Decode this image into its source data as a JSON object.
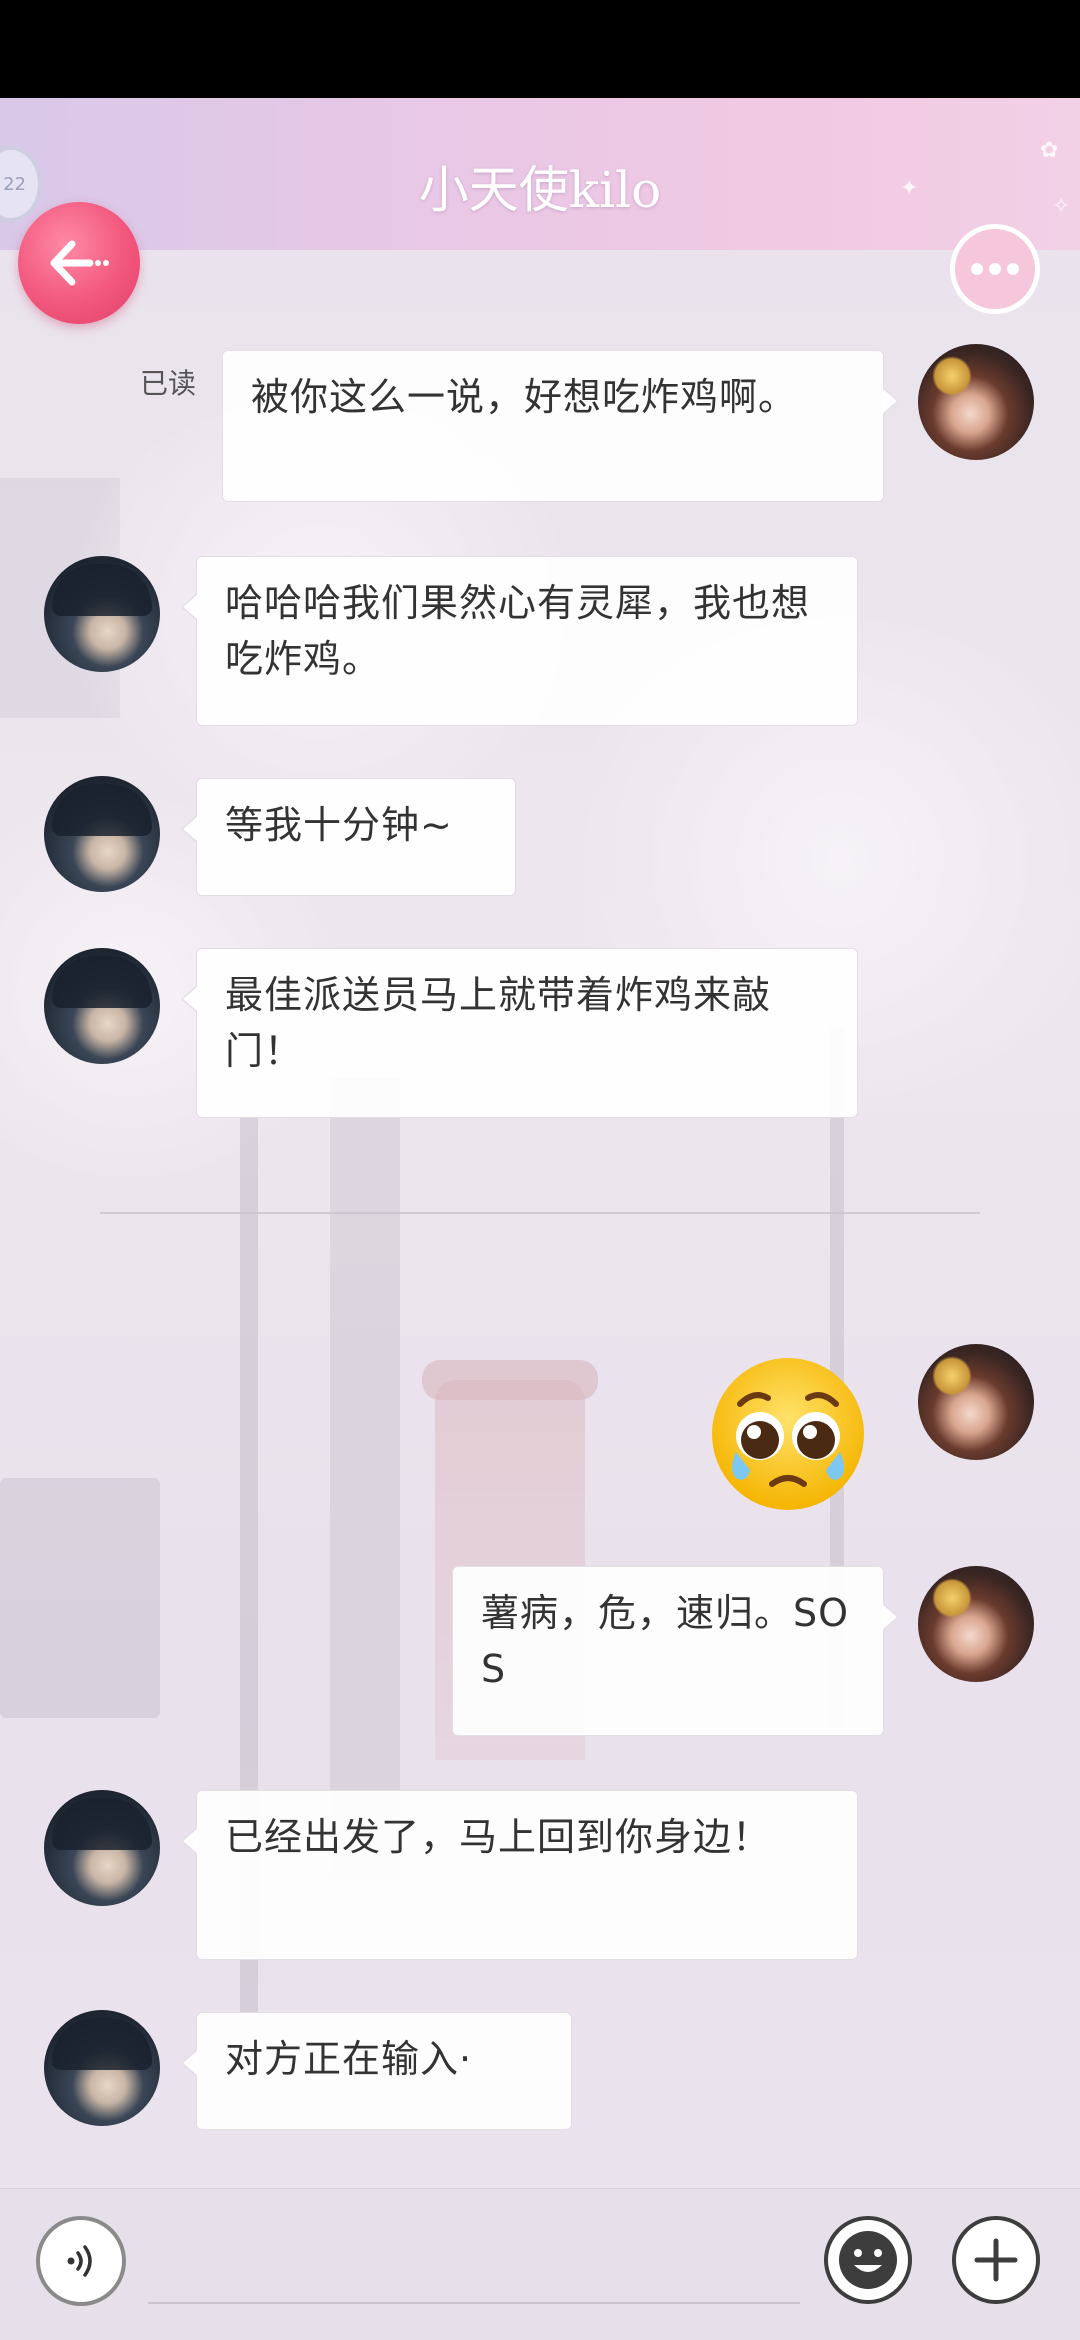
{
  "header": {
    "level_badge": "22",
    "title": "小天使kilo"
  },
  "messages": [
    {
      "side": "right",
      "read_label": "已读",
      "text": "被你这么一说，好想吃炸鸡啊。"
    },
    {
      "side": "left",
      "text": "哈哈哈我们果然心有灵犀，我也想吃炸鸡。"
    },
    {
      "side": "left",
      "text": "等我十分钟~"
    },
    {
      "side": "left",
      "text": "最佳派送员马上就带着炸鸡来敲门！"
    },
    {
      "side": "right",
      "sticker": "pleading-face-emoji"
    },
    {
      "side": "right",
      "text": "薯病，危，速归。SOS"
    },
    {
      "side": "left",
      "text": "已经出发了，马上回到你身边！"
    },
    {
      "side": "left",
      "text": "对方正在输入·"
    }
  ],
  "input_bar": {
    "value": "",
    "placeholder": "",
    "icons": [
      "voice-icon",
      "emoji-icon",
      "plus-icon"
    ]
  },
  "colors": {
    "back_button": "#f2577d",
    "header_gradient_start": "#d9c8e8",
    "header_gradient_end": "#f2d0e6",
    "bubble_bg": "#ffffff",
    "text": "#333333"
  }
}
